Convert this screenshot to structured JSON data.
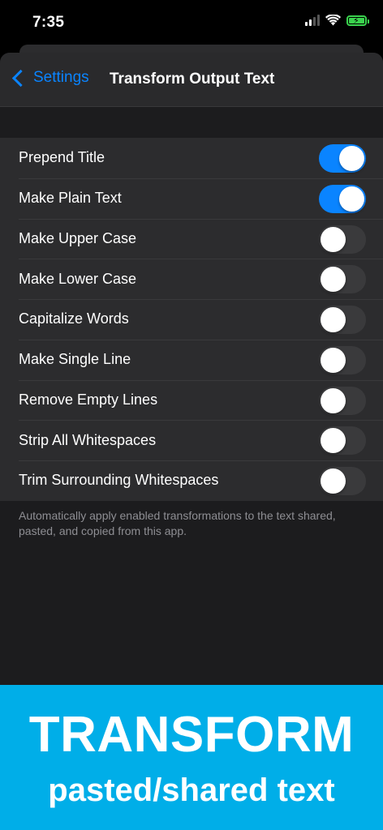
{
  "status_bar": {
    "time": "7:35",
    "signal_bars": 4,
    "signal_bars_filled": 2,
    "battery_charging": true
  },
  "nav": {
    "back_label": "Settings",
    "title": "Transform Output Text"
  },
  "settings": [
    {
      "label": "Prepend Title",
      "enabled": true
    },
    {
      "label": "Make Plain Text",
      "enabled": true
    },
    {
      "label": "Make Upper Case",
      "enabled": false
    },
    {
      "label": "Make Lower Case",
      "enabled": false
    },
    {
      "label": "Capitalize Words",
      "enabled": false
    },
    {
      "label": "Make Single Line",
      "enabled": false
    },
    {
      "label": "Remove Empty Lines",
      "enabled": false
    },
    {
      "label": "Strip All Whitespaces",
      "enabled": false
    },
    {
      "label": "Trim Surrounding Whitespaces",
      "enabled": false
    }
  ],
  "footer_note": "Automatically apply enabled transformations to the text shared, pasted, and copied from this app.",
  "banner": {
    "title": "TRANSFORM",
    "subtitle": "pasted/shared text"
  },
  "colors": {
    "accent": "#0a84ff",
    "banner": "#00aee8",
    "battery": "#3ad34e"
  }
}
